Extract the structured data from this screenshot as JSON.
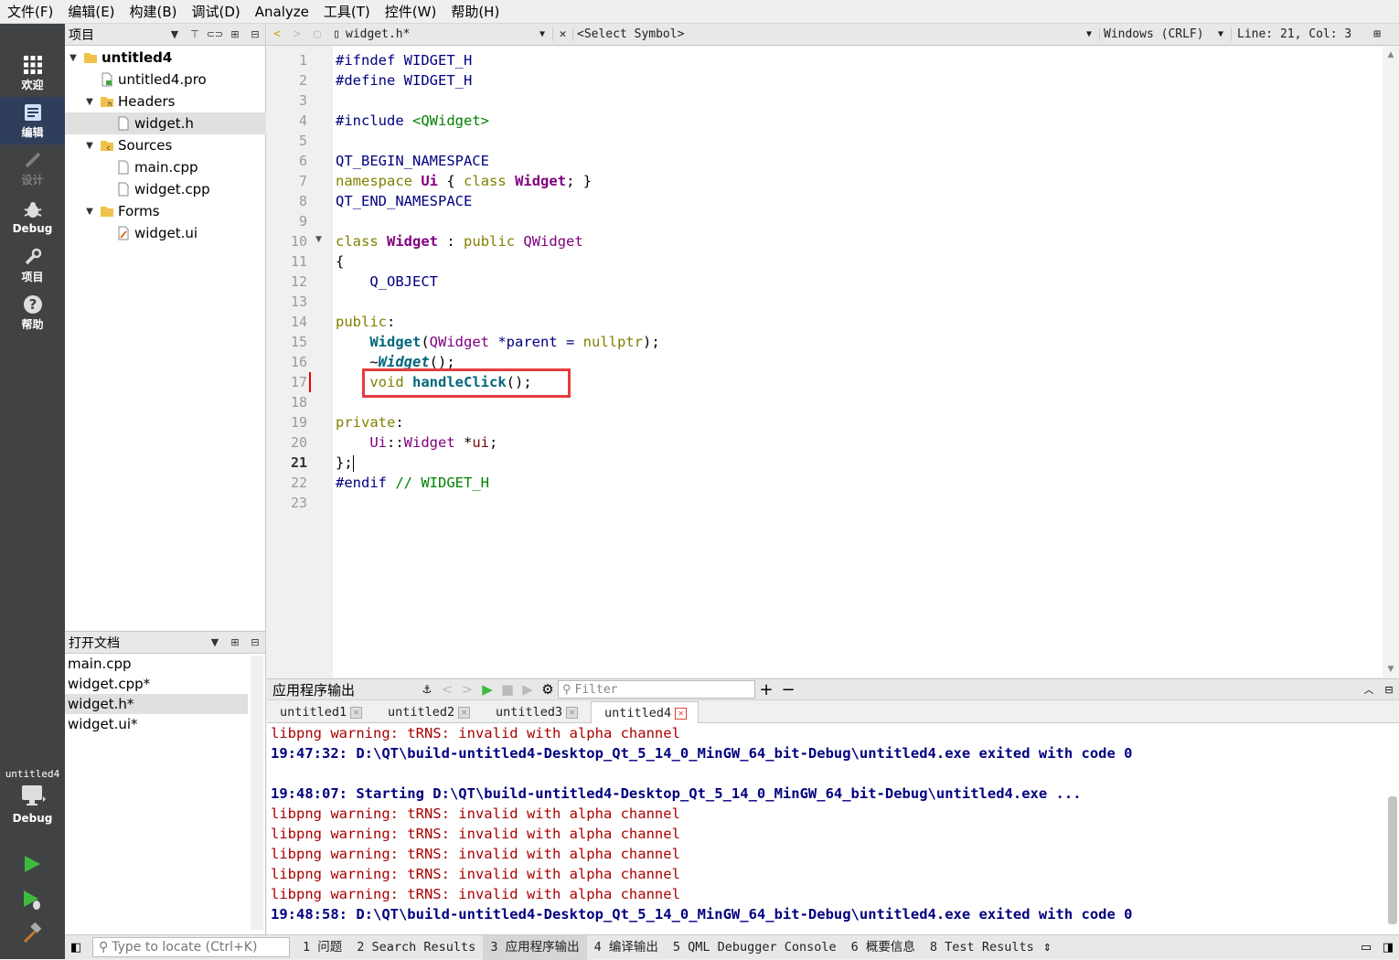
{
  "menubar": {
    "items": [
      "文件(F)",
      "编辑(E)",
      "构建(B)",
      "调试(D)",
      "Analyze",
      "工具(T)",
      "控件(W)",
      "帮助(H)"
    ]
  },
  "modes": {
    "welcome": "欢迎",
    "edit": "编辑",
    "design": "设计",
    "debug": "Debug",
    "projects": "项目",
    "help": "帮助"
  },
  "kit": {
    "project": "untitled4",
    "mode": "Debug"
  },
  "project_panel": {
    "title": "项目"
  },
  "project_tree": {
    "root": "untitled4",
    "pro": "untitled4.pro",
    "headers": "Headers",
    "widget_h": "widget.h",
    "sources": "Sources",
    "main_cpp": "main.cpp",
    "widget_cpp": "widget.cpp",
    "forms": "Forms",
    "widget_ui": "widget.ui"
  },
  "open_docs": {
    "title": "打开文档",
    "items": [
      "main.cpp",
      "widget.cpp*",
      "widget.h*",
      "widget.ui*"
    ]
  },
  "editor_toolbar": {
    "file": "widget.h*",
    "symbol": "<Select Symbol>",
    "line_ending": "Windows (CRLF)",
    "position": "Line: 21, Col: 3"
  },
  "editor": {
    "current_line": 21,
    "line_count": 23,
    "lines": {
      "l1a": "#ifndef",
      "l1b": " WIDGET_H",
      "l2a": "#define",
      "l2b": " WIDGET_H",
      "l4a": "#include",
      "l4b": "<QWidget>",
      "l6": "QT_BEGIN_NAMESPACE",
      "l7a": "namespace",
      "l7b": "Ui",
      "l7c": "{",
      "l7d": "class",
      "l7e": "Widget",
      "l7f": "; }",
      "l8": "QT_END_NAMESPACE",
      "l10a": "class",
      "l10b": "Widget",
      "l10c": ":",
      "l10d": "public",
      "l10e": "QWidget",
      "l11": "{",
      "l12": "Q_OBJECT",
      "l14a": "public",
      "l14b": ":",
      "l15a": "Widget",
      "l15b": "(",
      "l15c": "QWidget",
      "l15d": " *parent = ",
      "l15e": "nullptr",
      "l15f": ");",
      "l16a": "~",
      "l16b": "Widget",
      "l16c": "();",
      "l17a": "void",
      "l17b": "handleClick",
      "l17c": "();",
      "l19a": "private",
      "l19b": ":",
      "l20a": "Ui",
      "l20b": "::",
      "l20c": "Widget",
      "l20d": " *",
      "l20e": "ui",
      "l20f": ";",
      "l21": "};",
      "l22a": "#endif",
      "l22b": "// WIDGET_H"
    }
  },
  "output": {
    "title": "应用程序输出",
    "filter_placeholder": "Filter",
    "tabs": [
      "untitled1",
      "untitled2",
      "untitled3",
      "untitled4"
    ],
    "lines": [
      "libpng warning: tRNS: invalid with alpha channel",
      "19:47:32: D:\\QT\\build-untitled4-Desktop_Qt_5_14_0_MinGW_64_bit-Debug\\untitled4.exe exited with code 0",
      "",
      "19:48:07: Starting D:\\QT\\build-untitled4-Desktop_Qt_5_14_0_MinGW_64_bit-Debug\\untitled4.exe ...",
      "libpng warning: tRNS: invalid with alpha channel",
      "libpng warning: tRNS: invalid with alpha channel",
      "libpng warning: tRNS: invalid with alpha channel",
      "libpng warning: tRNS: invalid with alpha channel",
      "libpng warning: tRNS: invalid with alpha channel",
      "19:48:58: D:\\QT\\build-untitled4-Desktop_Qt_5_14_0_MinGW_64_bit-Debug\\untitled4.exe exited with code 0"
    ]
  },
  "statusbar": {
    "locate_placeholder": "Type to locate (Ctrl+K)",
    "panes": [
      "1 问题",
      "2 Search Results",
      "3 应用程序输出",
      "4 编译输出",
      "5 QML Debugger Console",
      "6 概要信息",
      "8 Test Results"
    ]
  },
  "colors": {
    "mode_bar": "#404244",
    "highlight_box": "#e53c3c",
    "warning_text": "#aa0000",
    "info_text": "#000080"
  }
}
